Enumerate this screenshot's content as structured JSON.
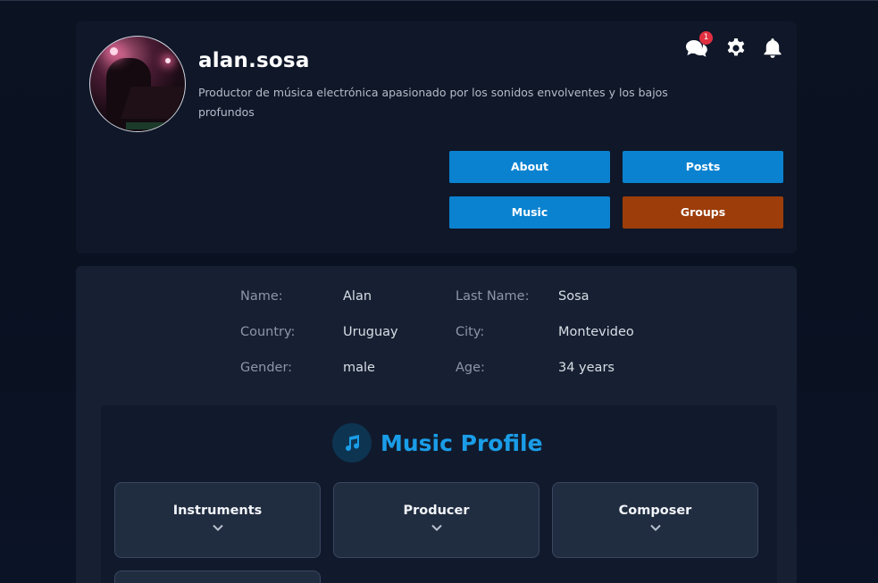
{
  "profile": {
    "username": "alan.sosa",
    "bio": "Productor de música electrónica apasionado por los sonidos envolventes y los bajos profundos",
    "notification_count": "1"
  },
  "icons": {
    "chat": "chat-bubbles-icon",
    "settings": "gear-icon",
    "notifications": "bell-icon",
    "music": "music-note-icon",
    "expand": "chevron-down-icon"
  },
  "nav": {
    "about": "About",
    "posts": "Posts",
    "music": "Music",
    "groups": "Groups"
  },
  "details": {
    "name_label": "Name:",
    "name_value": "Alan",
    "lastname_label": "Last Name:",
    "lastname_value": "Sosa",
    "country_label": "Country:",
    "country_value": "Uruguay",
    "city_label": "City:",
    "city_value": "Montevideo",
    "gender_label": "Gender:",
    "gender_value": "male",
    "age_label": "Age:",
    "age_value": "34 years"
  },
  "music_profile": {
    "title": "Music Profile",
    "sections": [
      "Instruments",
      "Producer",
      "Composer"
    ]
  },
  "colors": {
    "primary_button": "#0a82d0",
    "groups_button": "#9c3d0a",
    "accent": "#1a9de8",
    "badge": "#e03040"
  }
}
